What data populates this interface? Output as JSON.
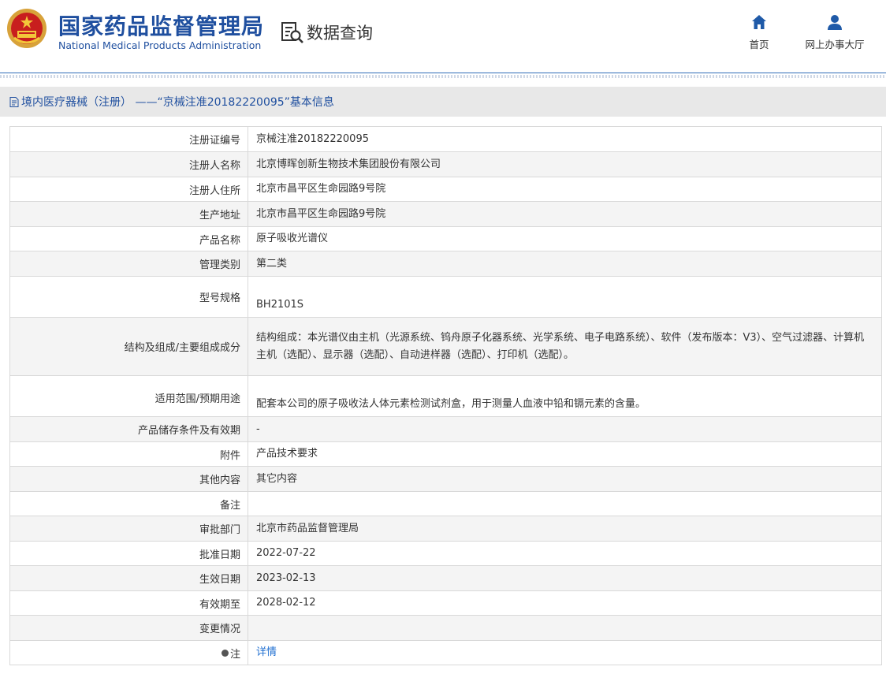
{
  "header": {
    "brand_cn": "国家药品监督管理局",
    "brand_en": "National Medical Products Administration",
    "search_label": "数据查询",
    "nav": [
      {
        "label": "首页",
        "icon": "home-icon"
      },
      {
        "label": "网上办事大厅",
        "icon": "user-icon"
      }
    ],
    "colors": {
      "brand": "#1f4f9f",
      "accent": "#2f6cb8"
    }
  },
  "breadcrumb": {
    "text": "境内医疗器械（注册） ——“京械注准20182220095”基本信息",
    "icon": "document-icon"
  },
  "detail": {
    "rows": [
      {
        "label": "注册证编号",
        "value": "京械注准20182220095"
      },
      {
        "label": "注册人名称",
        "value": "北京博晖创新生物技术集团股份有限公司"
      },
      {
        "label": "注册人住所",
        "value": "北京市昌平区生命园路9号院"
      },
      {
        "label": "生产地址",
        "value": "北京市昌平区生命园路9号院"
      },
      {
        "label": "产品名称",
        "value": "原子吸收光谱仪"
      },
      {
        "label": "管理类别",
        "value": "第二类"
      },
      {
        "label": "型号规格",
        "value": "BH2101S"
      },
      {
        "label": "结构及组成/主要组成成分",
        "value": "结构组成：本光谱仪由主机（光源系统、钨舟原子化器系统、光学系统、电子电路系统）、软件（发布版本：V3）、空气过滤器、计算机主机（选配）、显示器（选配）、自动进样器（选配）、打印机（选配）。"
      },
      {
        "label": "适用范围/预期用途",
        "value": "配套本公司的原子吸收法人体元素检测试剂盒，用于测量人血液中铅和镉元素的含量。"
      },
      {
        "label": "产品储存条件及有效期",
        "value": "-"
      },
      {
        "label": "附件",
        "value": "产品技术要求"
      },
      {
        "label": "其他内容",
        "value": "其它内容"
      },
      {
        "label": "备注",
        "value": ""
      },
      {
        "label": "审批部门",
        "value": "北京市药品监督管理局"
      },
      {
        "label": "批准日期",
        "value": "2022-07-22"
      },
      {
        "label": "生效日期",
        "value": "2023-02-13"
      },
      {
        "label": "有效期至",
        "value": "2028-02-12"
      },
      {
        "label": "变更情况",
        "value": ""
      },
      {
        "label": "注",
        "value": "详情"
      }
    ]
  }
}
